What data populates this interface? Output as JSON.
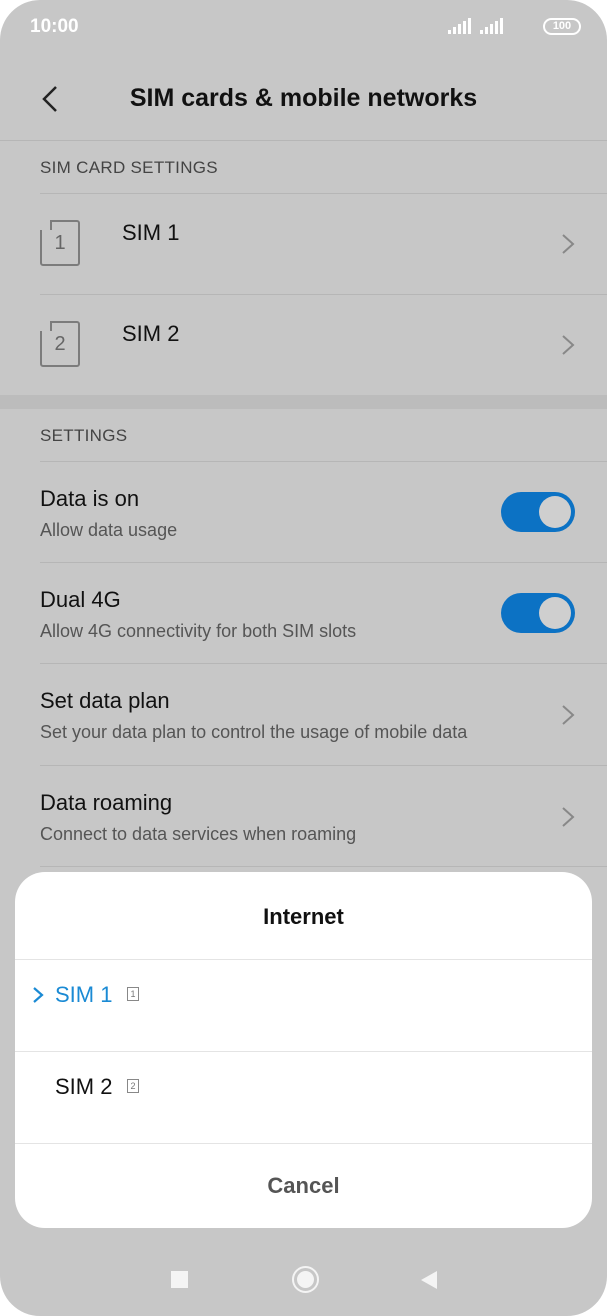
{
  "status_bar": {
    "time": "10:00",
    "battery": "100"
  },
  "header": {
    "title": "SIM cards & mobile networks"
  },
  "sim_section": {
    "header": "SIM CARD SETTINGS",
    "items": [
      {
        "number": "1",
        "label": "SIM 1"
      },
      {
        "number": "2",
        "label": "SIM 2"
      }
    ]
  },
  "settings_section": {
    "header": "SETTINGS",
    "items": [
      {
        "title": "Data is on",
        "subtitle": "Allow data usage",
        "control": "toggle",
        "on": true
      },
      {
        "title": "Dual 4G",
        "subtitle": "Allow 4G connectivity for both SIM slots",
        "control": "toggle",
        "on": true
      },
      {
        "title": "Set data plan",
        "subtitle": "Set your data plan to control the usage of mobile data",
        "control": "chevron"
      },
      {
        "title": "Data roaming",
        "subtitle": "Connect to data services when roaming",
        "control": "chevron"
      }
    ]
  },
  "dialog": {
    "title": "Internet",
    "options": [
      {
        "label": "SIM 1",
        "badge": "1",
        "selected": true
      },
      {
        "label": "SIM 2",
        "badge": "2",
        "selected": false
      }
    ],
    "cancel_label": "Cancel"
  },
  "colors": {
    "accent": "#1a8ad4",
    "toggle_on": "#0c72c4",
    "scrim_bg": "#c7c7c7"
  },
  "icons": [
    "back-icon",
    "chevron-right-icon",
    "sim-card-icon",
    "check-icon",
    "nav-recents-icon",
    "nav-home-icon",
    "nav-back-icon"
  ]
}
